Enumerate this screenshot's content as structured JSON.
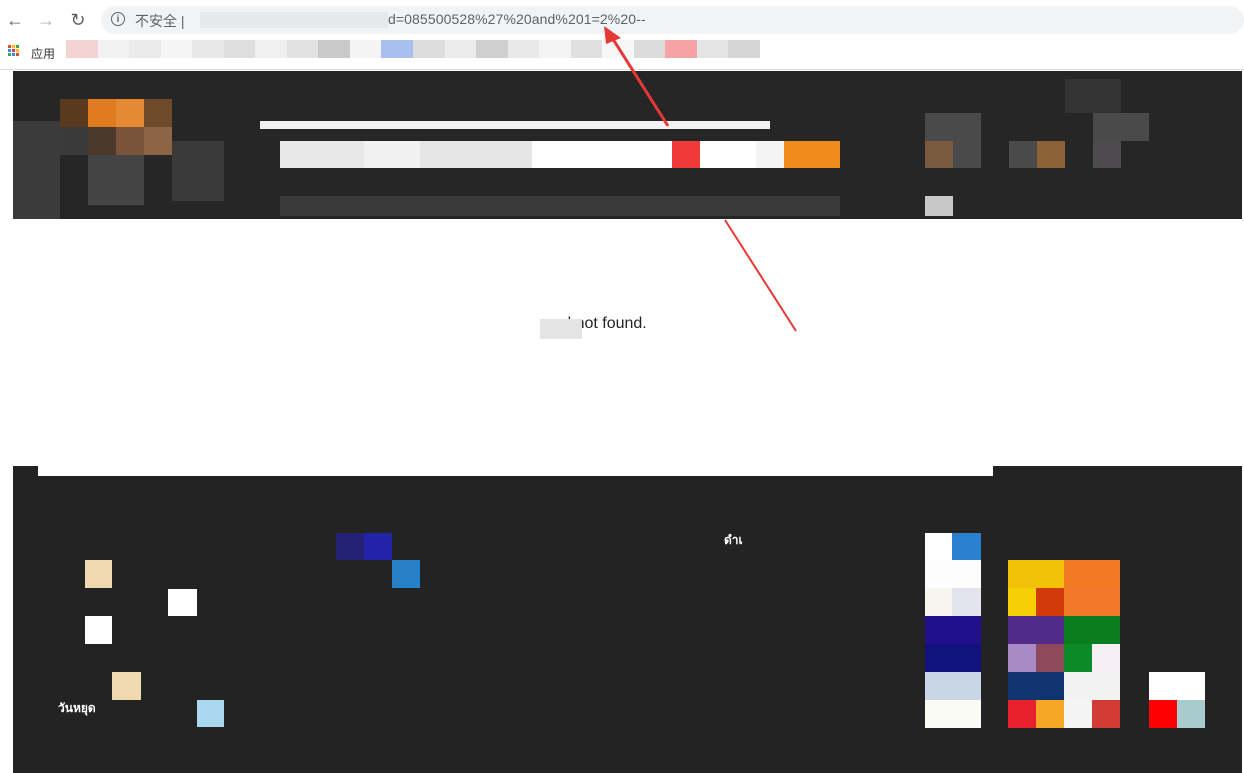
{
  "browser": {
    "nav": {
      "back_icon": "arrow-left-icon",
      "forward_icon": "arrow-right-icon",
      "reload_icon": "reload-icon",
      "back_glyph": "←",
      "forward_glyph": "→",
      "reload_glyph": "↻"
    },
    "address_bar": {
      "security_label": "不安全 |",
      "url_visible": "d=085500528%27%20and%201=2%20--"
    },
    "bookmarks": {
      "apps_label": "应用"
    }
  },
  "page": {
    "message": "cord not found."
  },
  "footer": {
    "label_left": "วันหยุด",
    "label_center": "ดำเ"
  },
  "annotation": {
    "color": "#e53935"
  }
}
